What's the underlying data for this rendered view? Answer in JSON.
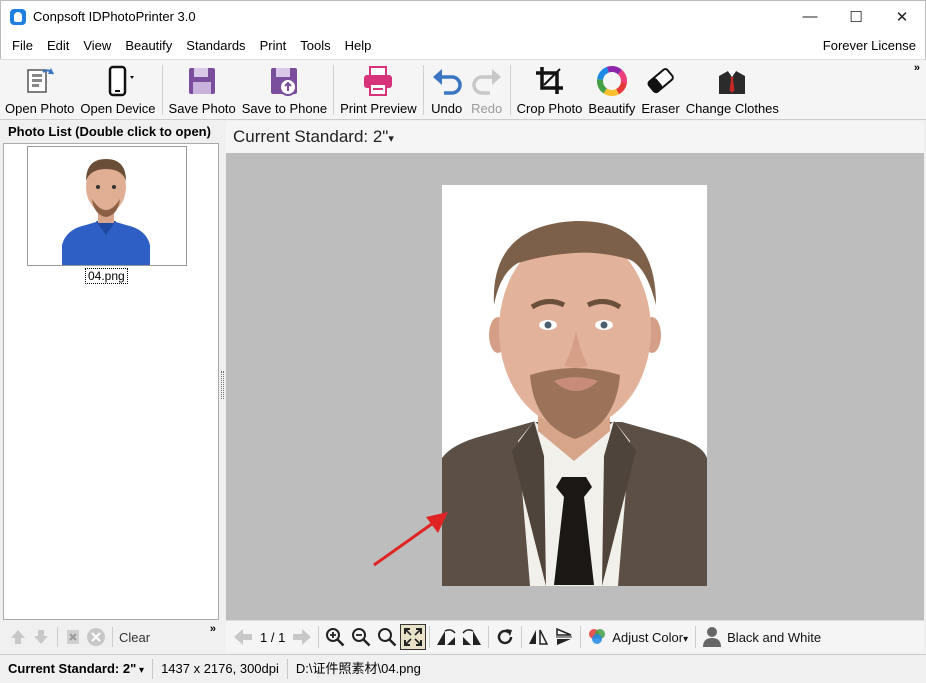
{
  "window": {
    "title": "Conpsoft IDPhotoPrinter 3.0",
    "controls": {
      "minimize": "—",
      "maximize": "☐",
      "close": "✕"
    }
  },
  "menubar": {
    "items": [
      "File",
      "Edit",
      "View",
      "Beautify",
      "Standards",
      "Print",
      "Tools",
      "Help"
    ],
    "license": "Forever License"
  },
  "toolbar": {
    "buttons": [
      {
        "label": "Open Photo",
        "icon": "open-photo-icon",
        "enabled": true
      },
      {
        "label": "Open Device",
        "icon": "phone-icon",
        "enabled": true
      },
      {
        "label": "Save Photo",
        "icon": "save-icon",
        "enabled": true
      },
      {
        "label": "Save to Phone",
        "icon": "save-to-phone-icon",
        "enabled": true
      },
      {
        "label": "Print Preview",
        "icon": "printer-icon",
        "enabled": true
      },
      {
        "label": "Undo",
        "icon": "undo-icon",
        "enabled": true
      },
      {
        "label": "Redo",
        "icon": "redo-icon",
        "enabled": false
      },
      {
        "label": "Crop Photo",
        "icon": "crop-icon",
        "enabled": true
      },
      {
        "label": "Beautify",
        "icon": "color-ring-icon",
        "enabled": true
      },
      {
        "label": "Eraser",
        "icon": "eraser-icon",
        "enabled": true
      },
      {
        "label": "Change Clothes",
        "icon": "suit-icon",
        "enabled": true
      }
    ],
    "more": "»"
  },
  "photo_list": {
    "header": "Photo List (Double click to open)",
    "items": [
      {
        "filename": "04.png"
      }
    ],
    "clear_label": "Clear",
    "more": "»"
  },
  "standard": {
    "header": "Current Standard: 2\"",
    "dropdown": "▾"
  },
  "bottom_tools": {
    "page_indicator": "1 / 1",
    "adjust_color_label": "Adjust Color",
    "black_white_label": "Black and White",
    "dropdown": "▾"
  },
  "statusbar": {
    "standard": "Current Standard: 2\"",
    "dimensions": "1437 x 2176, 300dpi",
    "path": "D:\\证件照素材\\04.png"
  },
  "colors": {
    "canvas_bg": "#bdbdbd",
    "accent_blue": "#1e7fe0",
    "save_purple": "#7a4e9c",
    "print_pink": "#d6337a",
    "undo_blue": "#3b76c2",
    "annotation_arrow": "#e02424"
  }
}
